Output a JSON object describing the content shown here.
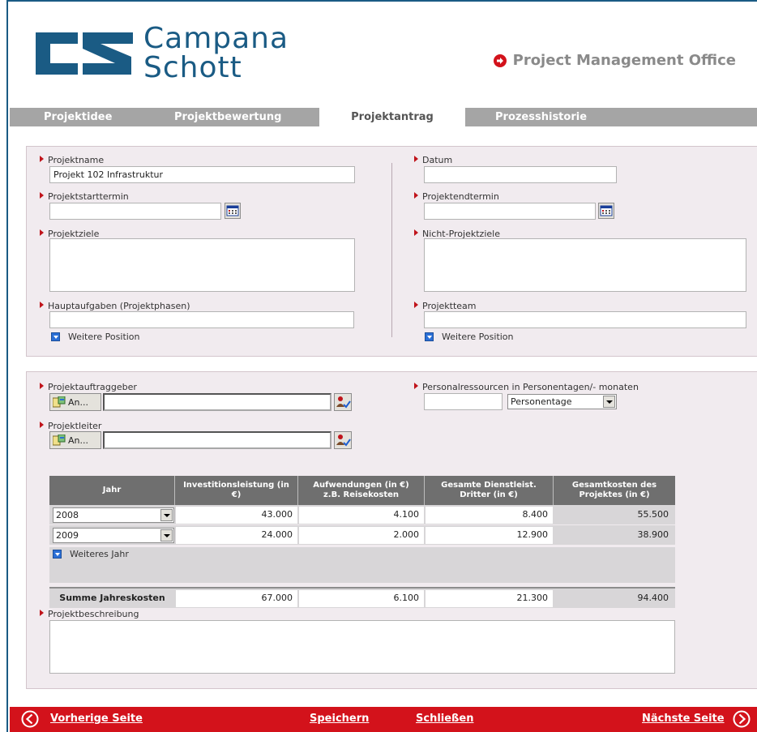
{
  "header": {
    "logo_line1": "Campana",
    "logo_line2": "Schott",
    "pmo_title": "Project Management Office"
  },
  "tabs": [
    "Projektidee",
    "Projektbewertung",
    "Projektantrag",
    "Prozesshistorie"
  ],
  "active_tab": "Projektantrag",
  "form": {
    "projektname_label": "Projektname",
    "projektname_value": "Projekt 102 Infrastruktur",
    "datum_label": "Datum",
    "datum_value": "",
    "startdatum_label": "Projektstarttermin",
    "startdatum_value": "",
    "enddatum_label": "Projektendtermin",
    "enddatum_value": "",
    "ziele_label": "Projektziele",
    "nichtziele_label": "Nicht-Projektziele",
    "hauptaufgaben_label": "Hauptaufgaben (Projektphasen)",
    "projektteam_label": "Projektteam",
    "weitere_position": "Weitere Position",
    "auftraggeber_label": "Projektauftraggeber",
    "projektleiter_label": "Projektleiter",
    "picker_button": "An...",
    "ressourcen_label": "Personalressourcen in Personentagen/- monaten",
    "ressourcen_value": "",
    "ressourcen_unit": "Personentage",
    "beschreibung_label": "Projektbeschreibung"
  },
  "cost_table": {
    "headers": [
      "Jahr",
      "Investitionsleistung (in €)",
      "Aufwendungen (in €) z.B. Reisekosten",
      "Gesamte Dienstleist. Dritter (in €)",
      "Gesamtkosten des Projektes (in €)"
    ],
    "rows": [
      {
        "year": "2008",
        "invest": "43.000",
        "aufw": "4.100",
        "dienst": "8.400",
        "gesamt": "55.500"
      },
      {
        "year": "2009",
        "invest": "24.000",
        "aufw": "2.000",
        "dienst": "12.900",
        "gesamt": "38.900"
      }
    ],
    "add_year": "Weiteres Jahr",
    "sum_label": "Summe Jahreskosten",
    "sum": {
      "invest": "67.000",
      "aufw": "6.100",
      "dienst": "21.300",
      "gesamt": "94.400"
    }
  },
  "footer": {
    "prev": "Vorherige Seite",
    "save": "Speichern",
    "close": "Schließen",
    "next": "Nächste Seite"
  },
  "colors": {
    "brand_blue": "#1a5b84",
    "accent_red": "#d3121b",
    "tab_grey": "#a5a5a5",
    "panel_bg": "#f1ebef"
  }
}
